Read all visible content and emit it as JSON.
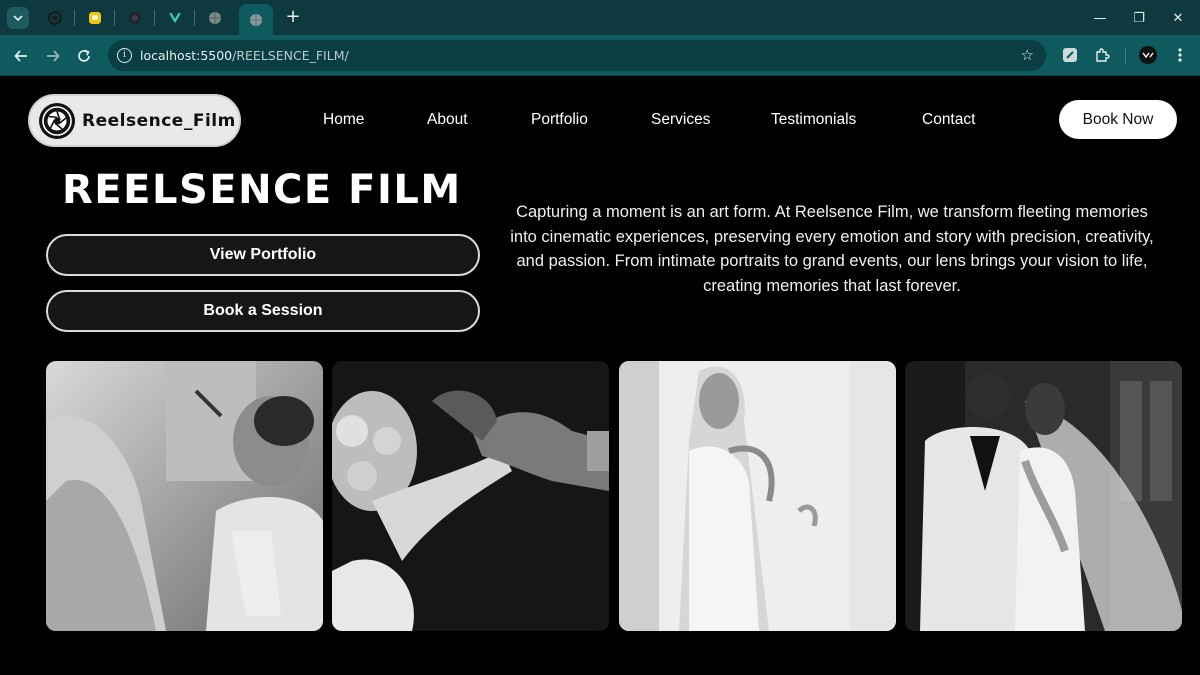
{
  "browser": {
    "url_host": "localhost:5500",
    "url_path": "/REELSENCE_FILM/",
    "new_tab_label": "+",
    "window_controls": {
      "minimize": "—",
      "maximize": "❐",
      "close": "✕"
    }
  },
  "brand": {
    "name": "Reelsence_Film",
    "logo_icon": "camera-aperture-icon"
  },
  "nav": {
    "items": [
      "Home",
      "About",
      "Portfolio",
      "Services",
      "Testimonials",
      "Contact"
    ],
    "book_now": "Book Now"
  },
  "hero": {
    "title": "REELSENCE FILM",
    "view_portfolio": "View Portfolio",
    "book_session": "Book a Session",
    "description": "Capturing a moment is an art form. At Reelsence Film, we transform fleeting memories into cinematic experiences, preserving every emotion and story with precision, creativity, and passion. From intimate portraits to grand events, our lens brings your vision to life, creating memories that last forever."
  },
  "gallery": {
    "photos": [
      {
        "subject": "bride-makeup-photo"
      },
      {
        "subject": "ring-exchange-photo"
      },
      {
        "subject": "bride-veil-photo"
      },
      {
        "subject": "couple-portrait-photo"
      }
    ]
  },
  "colors": {
    "chrome_dark": "#0e3a3f",
    "chrome_toolbar": "#0f5a5f",
    "page_bg": "#000000",
    "button_bg": "#161616"
  }
}
